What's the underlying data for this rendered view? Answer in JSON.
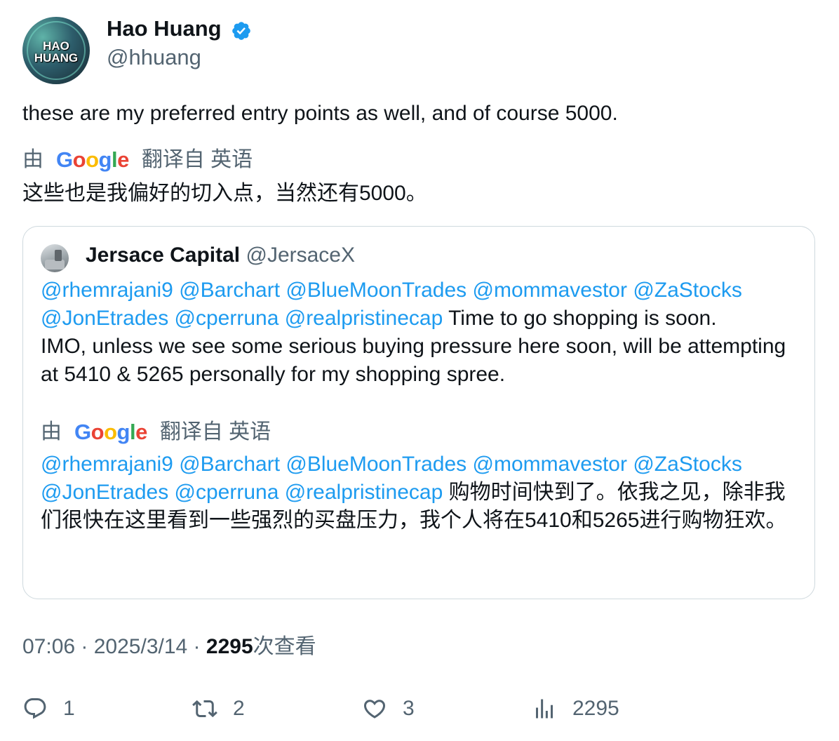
{
  "author": {
    "name": "Hao Huang",
    "handle": "@hhuang",
    "avatar_text": [
      "HAO",
      "HUANG"
    ],
    "verified_icon": "verified-badge-icon",
    "verified_color": "#1d9bf0"
  },
  "tweet": {
    "text": "these are my preferred entry points as well, and of course 5000.",
    "translation_prefix": "由",
    "translation_brand": "Google",
    "translation_suffix": "翻译自 英语",
    "translated_text": "这些也是我偏好的切入点，当然还有5000。"
  },
  "quote": {
    "name": "Jersace Capital",
    "handle": "@JersaceX",
    "mentions_line1": "@rhemrajani9 @Barchart @BlueMoonTrades @mommavestor @ZaStocks",
    "mentions_line2": "@JonEtrades @cperruna @realpristinecap",
    "text_part": " Time to go shopping is soon.",
    "text_rest": "IMO, unless we see some serious buying pressure here soon, will be attempting at 5410 & 5265 personally for my shopping spree.",
    "translation_prefix": "由",
    "translation_brand": "Google",
    "translation_suffix": "翻译自 英语",
    "tr_mentions_line1": "@rhemrajani9 @Barchart @BlueMoonTrades @mommavestor @ZaStocks",
    "tr_mentions_line2": "@JonEtrades @cperruna @realpristinecap",
    "tr_text": " 购物时间快到了。依我之见，除非我们很快在这里看到一些强烈的买盘压力，我个人将在5410和5265进行购物狂欢。"
  },
  "meta": {
    "time": "07:06",
    "sep1": " · ",
    "date": "2025/3/14",
    "sep2": " · ",
    "views": "2295",
    "views_label": "次查看"
  },
  "actions": {
    "reply_count": "1",
    "retweet_count": "2",
    "like_count": "3",
    "view_count": "2295"
  },
  "colors": {
    "link": "#1d9bf0",
    "secondary": "#536471",
    "primary": "#0f1419",
    "border": "#cfd9de"
  }
}
